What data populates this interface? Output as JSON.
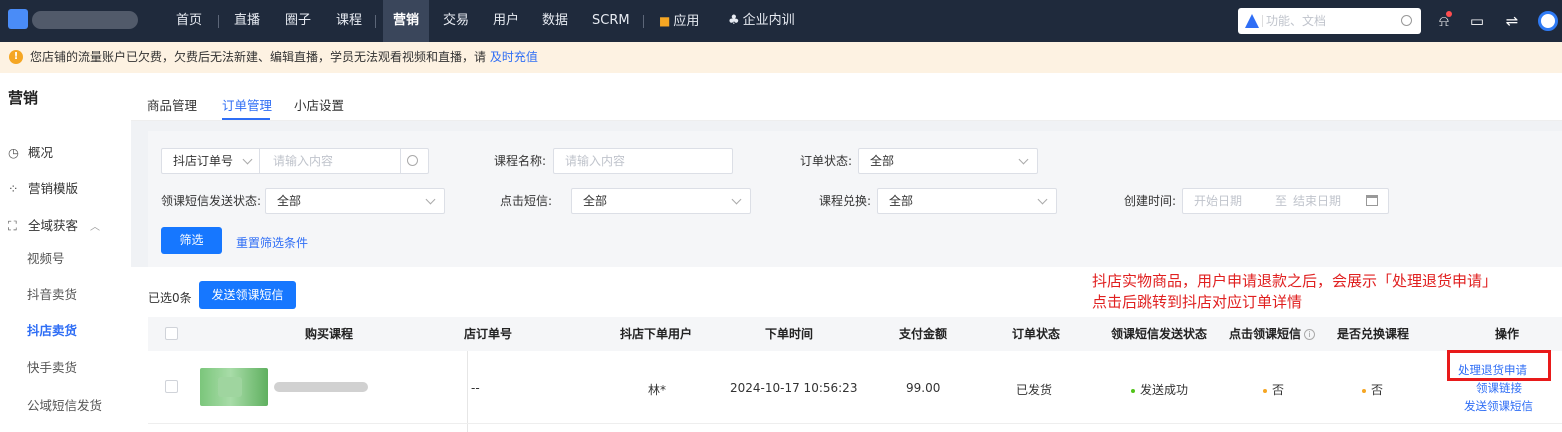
{
  "nav": {
    "items": [
      "首页",
      "直播",
      "圈子",
      "课程",
      "营销",
      "交易",
      "用户",
      "数据",
      "SCRM",
      "应用",
      "企业内训"
    ],
    "active": "营销",
    "search_placeholder": "功能、文档"
  },
  "warning": {
    "text": "您店铺的流量账户已欠费，欠费后无法新建、编辑直播，学员无法观看视频和直播，请",
    "link": "及时充值"
  },
  "sidebar": {
    "title": "营销",
    "items": [
      "概况",
      "营销模版",
      "全域获客"
    ],
    "subitems": [
      "视频号",
      "抖音卖货",
      "抖店卖货",
      "快手卖货",
      "公域短信发货"
    ],
    "active_sub": "抖店卖货"
  },
  "tabs": [
    "商品管理",
    "订单管理",
    "小店设置"
  ],
  "filters": {
    "order_type": "抖店订单号",
    "order_placeholder": "请输入内容",
    "course_label": "课程名称:",
    "course_placeholder": "请输入内容",
    "status_label": "订单状态:",
    "status_value": "全部",
    "sms_label": "领课短信发送状态:",
    "sms_value": "全部",
    "click_label": "点击短信:",
    "click_value": "全部",
    "redeem_label": "课程兑换:",
    "redeem_value": "全部",
    "created_label": "创建时间:",
    "start_placeholder": "开始日期",
    "to": "至",
    "end_placeholder": "结束日期",
    "filter_button": "筛选",
    "reset_link": "重置筛选条件"
  },
  "list": {
    "selected": "已选0条",
    "send_button": "发送领课短信"
  },
  "annotation": {
    "line1": "抖店实物商品，用户申请退款之后，会展示「处理退货申请」",
    "line2": "点击后跳转到抖店对应订单详情"
  },
  "table": {
    "headers": [
      "购买课程",
      "店订单号",
      "抖店下单用户",
      "下单时间",
      "支付金额",
      "订单状态",
      "领课短信发送状态",
      "点击领课短信",
      "是否兑换课程",
      "操作"
    ],
    "row": {
      "order_no": "--",
      "user": "林*",
      "time": "2024-10-17 10:56:23",
      "amount": "99.00",
      "status": "已发货",
      "sms_status": "发送成功",
      "clicked": "否",
      "redeemed": "否",
      "ops": [
        "处理退货申请",
        "领课链接",
        "发送领课短信"
      ]
    }
  }
}
